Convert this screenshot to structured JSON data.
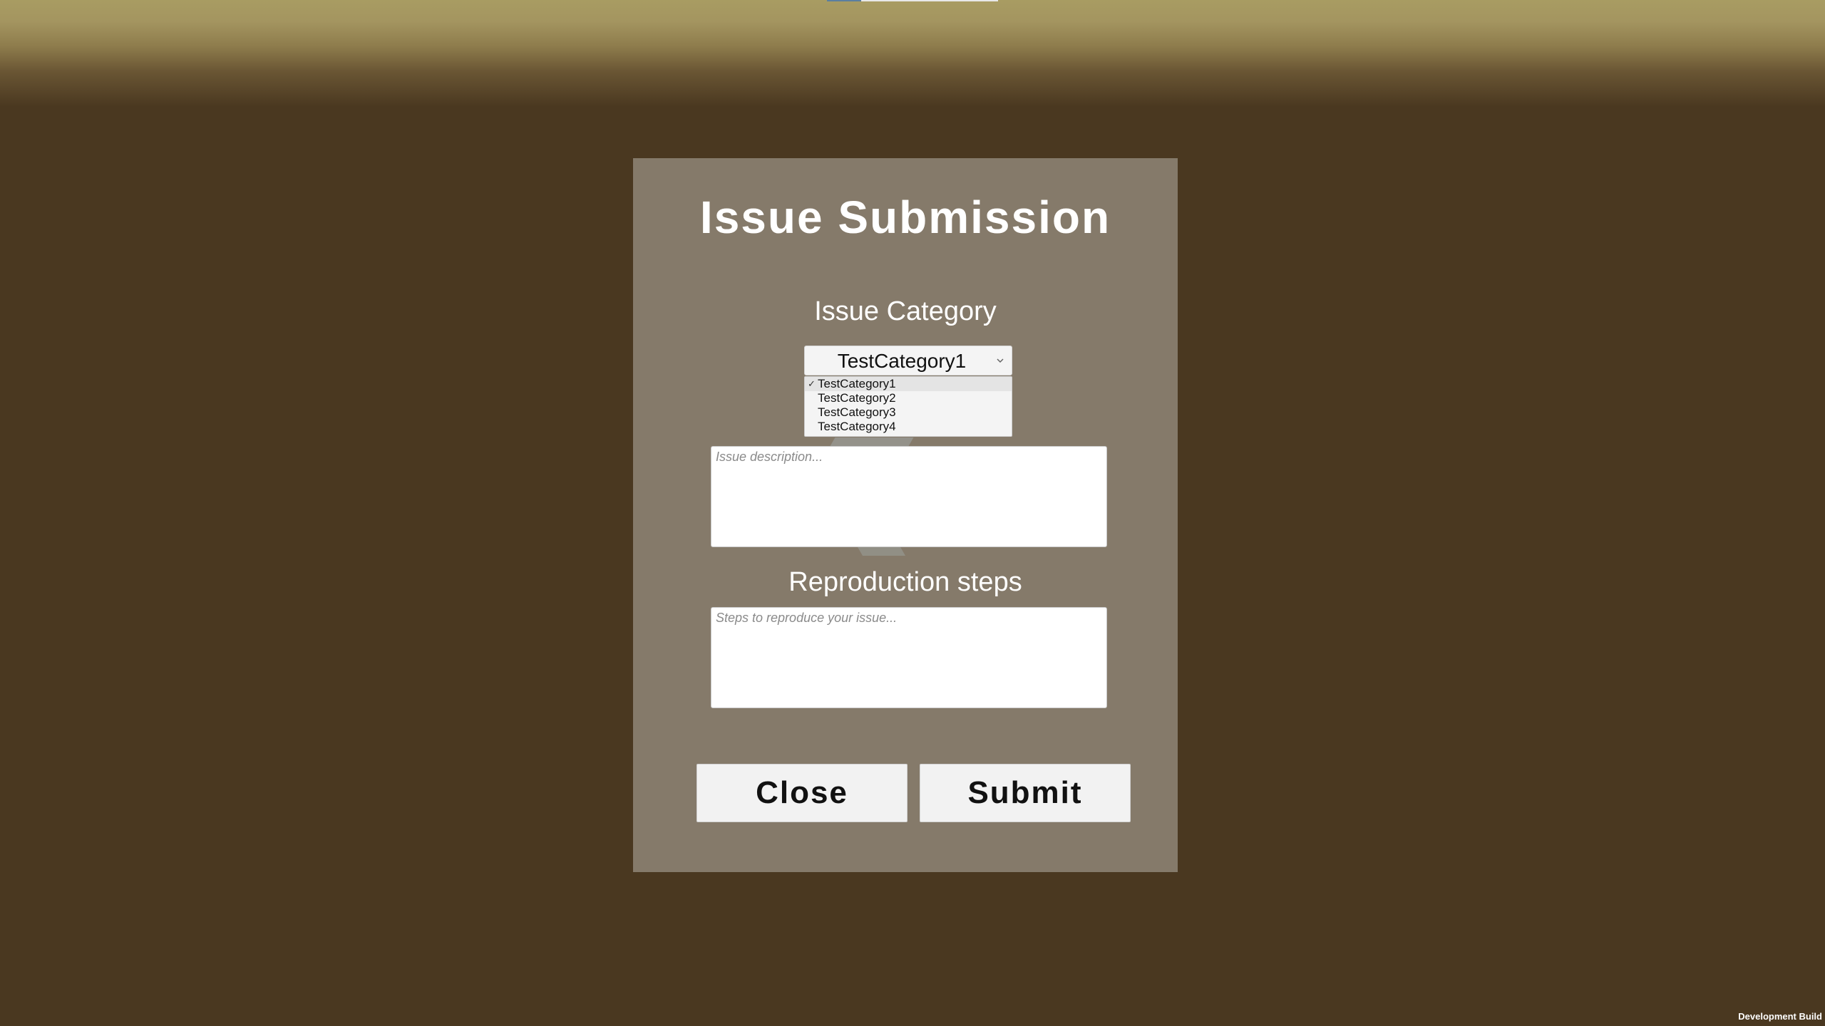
{
  "dialog": {
    "title": "Issue Submission",
    "category_label": "Issue Category",
    "category_selected": "TestCategory1",
    "category_options": [
      "TestCategory1",
      "TestCategory2",
      "TestCategory3",
      "TestCategory4"
    ],
    "description_placeholder": "Issue description...",
    "steps_label": "Reproduction steps",
    "steps_placeholder": "Steps to reproduce your issue...",
    "close_label": "Close",
    "submit_label": "Submit"
  },
  "footer": {
    "build_label": "Development Build"
  },
  "colors": {
    "background": "#4a3820",
    "panel": "#857a6a",
    "sky": "#a89c62"
  },
  "icons": [
    "chevron-down-icon",
    "checkmark-icon"
  ]
}
